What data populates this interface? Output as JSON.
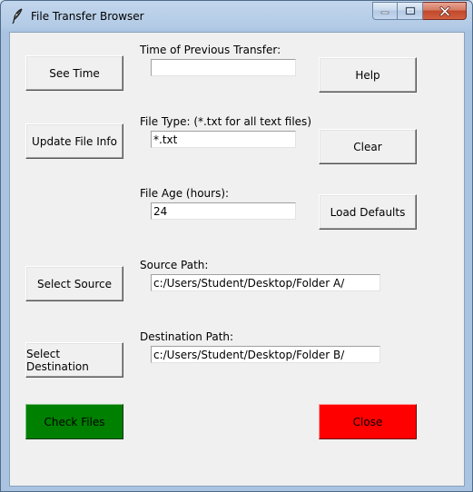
{
  "window": {
    "title": "File Transfer Browser"
  },
  "buttons": {
    "see_time": "See Time",
    "update_file_info": "Update File Info",
    "select_source": "Select Source",
    "select_destination": "Select Destination",
    "check_files": "Check Files",
    "help": "Help",
    "clear": "Clear",
    "load_defaults": "Load Defaults",
    "close": "Close"
  },
  "fields": {
    "previous_transfer": {
      "label": "Time of Previous Transfer:",
      "value": ""
    },
    "file_type": {
      "label": "File Type: (*.txt for all text files)",
      "value": "*.txt"
    },
    "file_age": {
      "label": "File Age (hours):",
      "value": "24"
    },
    "source_path": {
      "label": "Source Path:",
      "value": "c:/Users/Student/Desktop/Folder A/"
    },
    "destination_path": {
      "label": "Destination Path:",
      "value": "c:/Users/Student/Desktop/Folder B/"
    }
  },
  "colors": {
    "check_files_bg": "#008000",
    "close_bg": "#ff0000"
  }
}
